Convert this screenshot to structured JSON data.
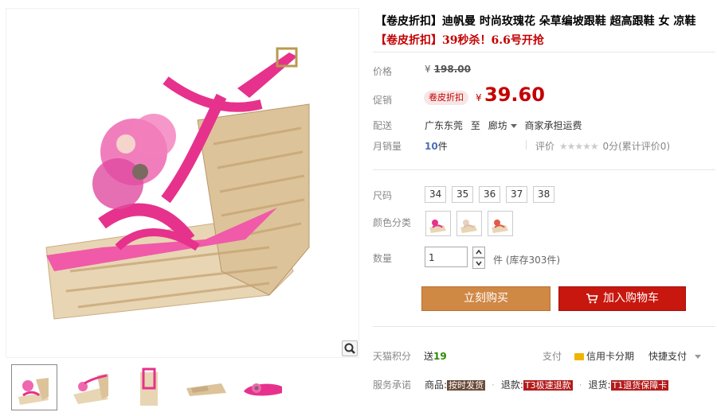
{
  "product": {
    "title": "【卷皮折扣】迪帆曼 时尚玫瑰花 朵草编坡跟鞋 超高跟鞋 女 凉鞋",
    "subtitle": "【卷皮折扣】39秒杀！6.6号开抢"
  },
  "price": {
    "label": "价格",
    "currency": "¥",
    "original": "198.00"
  },
  "promo": {
    "label": "促销",
    "tag": "卷皮折扣",
    "currency": "¥",
    "price": "39.60"
  },
  "shipping": {
    "label": "配送",
    "from": "广东东莞",
    "to_word": "至",
    "dest": "廊坊",
    "fee": "商家承担运费"
  },
  "sales": {
    "label": "月销量",
    "count": "10",
    "unit": "件",
    "rating_label": "评价",
    "stars": "★★★★★",
    "rating_text": "0分(累计评价0)"
  },
  "size": {
    "label": "尺码",
    "options": [
      "34",
      "35",
      "36",
      "37",
      "38"
    ]
  },
  "color": {
    "label": "颜色分类"
  },
  "quantity": {
    "label": "数量",
    "value": "1",
    "unit": "件",
    "stock": "(库存303件)"
  },
  "actions": {
    "buy_now": "立刻购买",
    "add_cart": "加入购物车"
  },
  "points": {
    "label": "天猫积分",
    "prefix": "送",
    "value": "19"
  },
  "payment": {
    "label": "支付",
    "card": "信用卡分期",
    "quick": "快捷支付"
  },
  "service": {
    "label": "服务承诺",
    "goods_label": "商品:",
    "goods_tag": "按时发货",
    "refund_label": "退款:",
    "refund_tag": "T3极速退款",
    "return_label": "退货:",
    "return_tag": "T1退货保障卡"
  },
  "colors": {
    "price_red": "#c40000",
    "buy_now_bg": "#d08845",
    "add_cart_bg": "#c8170e",
    "shoe_pink": "#e6328c"
  },
  "icons": [
    "zoom-icon",
    "cart-icon",
    "card-icon",
    "chevron-down-icon"
  ]
}
